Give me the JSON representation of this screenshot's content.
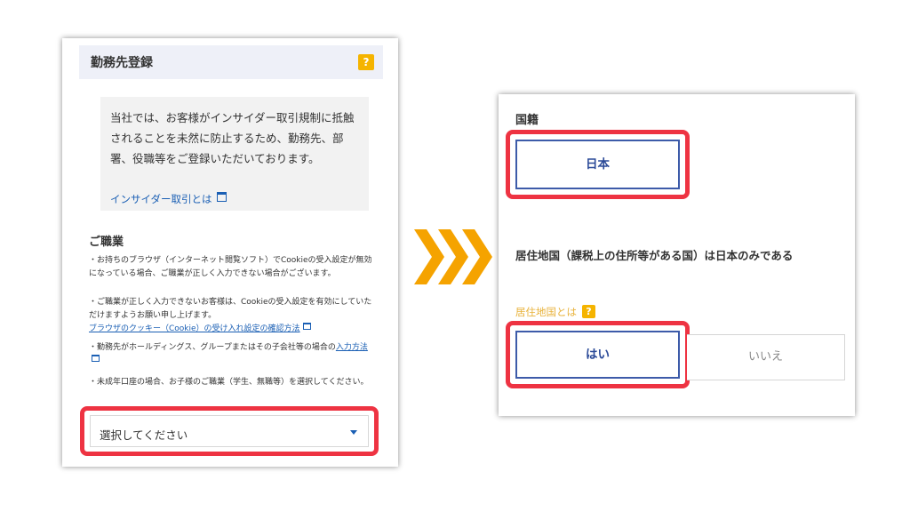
{
  "left_panel": {
    "title": "勤務先登録",
    "help_icon": "?",
    "notice": {
      "text": "当社では、お客様がインサイダー取引規制に抵触されることを未然に防止するため、勤務先、部署、役職等をご登録いただいております。",
      "link": "インサイダー取引とは"
    },
    "occupation": {
      "title": "ご職業",
      "note1": "・お持ちのブラウザ（インターネット閲覧ソフト）でCookieの受入設定が無効になっている場合、ご職業が正しく入力できない場合がございます。",
      "note2": "・ご職業が正しく入力できないお客様は、Cookieの受入設定を有効にしていただけますようお願い申し上げます。",
      "note2_link": "ブラウザのクッキー（Cookie）の受け入れ設定の確認方法",
      "note3_prefix": "・勤務先がホールディングス、グループまたはその子会社等の場合の",
      "note3_link": "入力方法",
      "note4": "・未成年口座の場合、お子様のご職業（学生、無職等）を選択してください。"
    },
    "select": {
      "value": "選択してください"
    }
  },
  "right_panel": {
    "nationality_label": "国籍",
    "nationality_value": "日本",
    "residence_question": "居住地国（課税上の住所等がある国）は日本のみである",
    "residence_link": "居住地国とは",
    "help_icon": "?",
    "yes_label": "はい",
    "no_label": "いいえ"
  },
  "colors": {
    "highlight": "#ee3342",
    "accent_blue": "#2b4a98",
    "link_blue": "#1a5fb4",
    "arrow_orange": "#f5a300",
    "help_yellow": "#f5b400"
  }
}
